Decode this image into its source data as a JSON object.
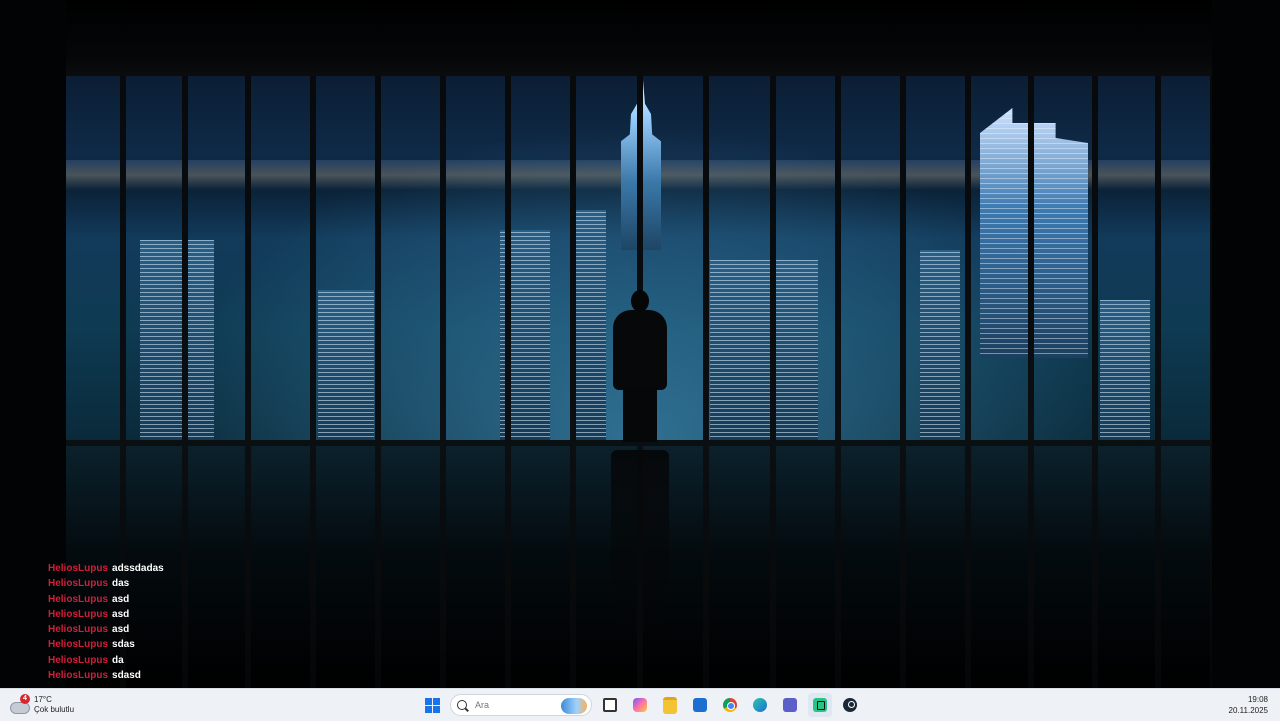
{
  "chat": {
    "messages": [
      {
        "user": "HeliosLupus",
        "text": "adssdadas"
      },
      {
        "user": "HeliosLupus",
        "text": "das"
      },
      {
        "user": "HeliosLupus",
        "text": "asd"
      },
      {
        "user": "HeliosLupus",
        "text": "asd"
      },
      {
        "user": "HeliosLupus",
        "text": "asd"
      },
      {
        "user": "HeliosLupus",
        "text": "sdas"
      },
      {
        "user": "HeliosLupus",
        "text": "da"
      },
      {
        "user": "HeliosLupus",
        "text": "sdasd"
      }
    ],
    "user_color": "#d21e3a"
  },
  "taskbar": {
    "weather": {
      "badge": "4",
      "temperature": "17°C",
      "condition": "Çok bulutlu",
      "icon": "cloud-icon"
    },
    "search": {
      "placeholder": "Ara"
    },
    "apps": [
      "start-icon",
      "search-icon",
      "task-view-icon",
      "copilot-icon",
      "file-explorer-icon",
      "outlook-icon",
      "chrome-icon",
      "edge-icon",
      "teams-icon",
      "twitch-icon",
      "steam-icon"
    ],
    "clock": {
      "time": "19:08",
      "date": "20.11.2025"
    }
  },
  "wallpaper": {
    "description_colors": {
      "sky": "#0f2a47",
      "lights": "#dff3ff"
    }
  }
}
